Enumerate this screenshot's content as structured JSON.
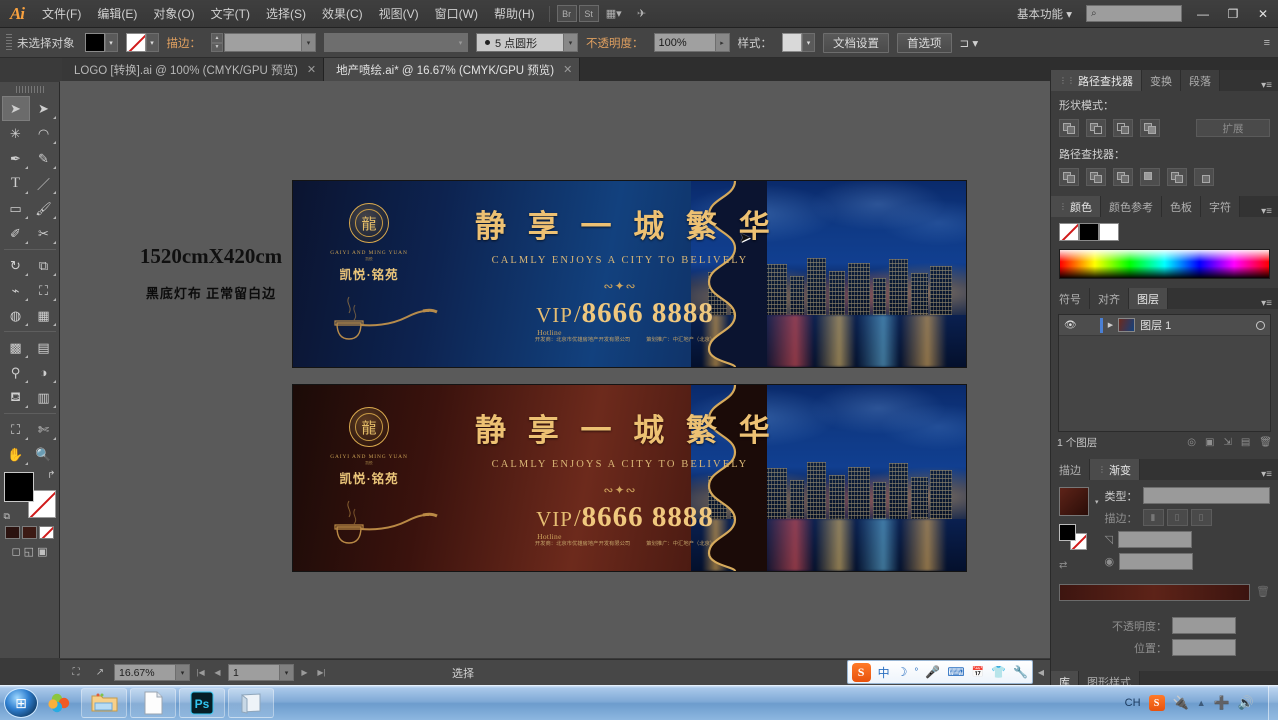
{
  "app": {
    "logo": "Ai",
    "title": "Adobe Illustrator"
  },
  "menubar": {
    "items": [
      "文件(F)",
      "编辑(E)",
      "对象(O)",
      "文字(T)",
      "选择(S)",
      "效果(C)",
      "视图(V)",
      "窗口(W)",
      "帮助(H)"
    ],
    "br_icon": "Br",
    "st_icon": "St",
    "arrange_icon": "arrange-documents-icon",
    "workspace": "基本功能",
    "search_placeholder": "",
    "win_min": "—",
    "win_max": "❐",
    "win_close": "✕"
  },
  "controlbar": {
    "selection_label": "未选择对象",
    "fill_color": "#000000",
    "stroke_color": "none",
    "stroke_label": "描边：",
    "stroke_weight": "",
    "profile": "",
    "brush": "5 点圆形",
    "opacity_label": "不透明度：",
    "opacity_value": "100%",
    "style_label": "样式：",
    "doc_setup": "文档设置",
    "preferences": "首选项"
  },
  "tabs": [
    {
      "label": "LOGO [转换].ai @ 100% (CMYK/GPU 预览)",
      "active": false,
      "close": "✕"
    },
    {
      "label": "地产喷绘.ai* @ 16.67% (CMYK/GPU 预览)",
      "active": true,
      "close": "✕"
    }
  ],
  "toolbar": {
    "tools": [
      {
        "name": "selection-tool",
        "glyph": "➤",
        "selected": true
      },
      {
        "name": "direct-selection-tool",
        "glyph": "➤",
        "selected": false
      },
      {
        "name": "magic-wand-tool",
        "glyph": "✳",
        "selected": false
      },
      {
        "name": "lasso-tool",
        "glyph": "◠",
        "selected": false
      },
      {
        "name": "pen-tool",
        "glyph": "✒",
        "selected": false
      },
      {
        "name": "curvature-tool",
        "glyph": "✎",
        "selected": false
      },
      {
        "name": "type-tool",
        "glyph": "T",
        "selected": false
      },
      {
        "name": "line-segment-tool",
        "glyph": "／",
        "selected": false
      },
      {
        "name": "rectangle-tool",
        "glyph": "▭",
        "selected": false
      },
      {
        "name": "paintbrush-tool",
        "glyph": "🖌",
        "selected": false
      },
      {
        "name": "pencil-tool",
        "glyph": "✐",
        "selected": false
      },
      {
        "name": "scissors-tool",
        "glyph": "✂",
        "selected": false
      },
      {
        "name": "rotate-tool",
        "glyph": "↻",
        "selected": false
      },
      {
        "name": "scale-tool",
        "glyph": "⤢",
        "selected": false
      },
      {
        "name": "width-tool",
        "glyph": "⌁",
        "selected": false
      },
      {
        "name": "free-transform-tool",
        "glyph": "⧉",
        "selected": false
      },
      {
        "name": "shape-builder-tool",
        "glyph": "◍",
        "selected": false
      },
      {
        "name": "perspective-grid-tool",
        "glyph": "▦",
        "selected": false
      },
      {
        "name": "mesh-tool",
        "glyph": "▩",
        "selected": false
      },
      {
        "name": "gradient-tool",
        "glyph": "▤",
        "selected": false
      },
      {
        "name": "eyedropper-tool",
        "glyph": "⚲",
        "selected": false
      },
      {
        "name": "blend-tool",
        "glyph": "◐",
        "selected": false
      },
      {
        "name": "symbol-sprayer-tool",
        "glyph": "⛾",
        "selected": false
      },
      {
        "name": "column-graph-tool",
        "glyph": "▥",
        "selected": false
      },
      {
        "name": "artboard-tool",
        "glyph": "⛶",
        "selected": false
      },
      {
        "name": "slice-tool",
        "glyph": "✄",
        "selected": false
      },
      {
        "name": "hand-tool",
        "glyph": "✋",
        "selected": false
      },
      {
        "name": "zoom-tool",
        "glyph": "🔍",
        "selected": false
      }
    ],
    "fill_color": "#000000",
    "stroke_color": "none",
    "swap_icon": "↱",
    "default_icon": "⧉",
    "mini_swatches": [
      "#2b1310",
      "#3c1a14",
      "none"
    ],
    "screen_modes": [
      "◻",
      "◱",
      "▣"
    ]
  },
  "canvas": {
    "note_size": "1520cmX420cm",
    "note_sub": "黑底灯布 正常留白边",
    "cursor": "arrow-cursor"
  },
  "artwork": {
    "banners": [
      {
        "variant": "blue",
        "logo_en": "GAIYI AND MING YUAN",
        "logo_tiny": "凯悦",
        "logo_cn": "凯悦·铭苑",
        "headline_cn": "静 享 一 城 繁 华",
        "headline_en": "CALMLY ENJOYS A CITY TO BELIVELY",
        "vip_word": "VIP",
        "vip_hotline": "Hotline",
        "vip_slash": "/",
        "vip_number": "8666 8888",
        "fine_left": "开发商：北京市优雄房地产开发有限公司",
        "fine_right": "策划推广：中汇地产（北京）"
      },
      {
        "variant": "brown",
        "logo_en": "GAIYI AND MING YUAN",
        "logo_tiny": "凯悦",
        "logo_cn": "凯悦·铭苑",
        "headline_cn": "静 享 一 城 繁 华",
        "headline_en": "CALMLY ENJOYS A CITY TO BELIVELY",
        "vip_word": "VIP",
        "vip_hotline": "Hotline",
        "vip_slash": "/",
        "vip_number": "8666 8888",
        "fine_left": "开发商：北京市优雄房地产开发有限公司",
        "fine_right": "策划推广：中汇地产（北京）"
      }
    ]
  },
  "panels": {
    "pathfinder": {
      "tabs": [
        "路径查找器",
        "变换",
        "段落"
      ],
      "active_tab": "路径查找器",
      "shape_modes_label": "形状模式：",
      "expand_label": "扩展",
      "pathfinder_label": "路径查找器：",
      "shape_mode_buttons": [
        "unite",
        "minus-front",
        "intersect",
        "exclude"
      ],
      "pathfinder_buttons": [
        "divide",
        "trim",
        "merge",
        "crop",
        "outline",
        "minus-back"
      ]
    },
    "color": {
      "tabs": [
        "颜色",
        "颜色参考",
        "色板",
        "字符"
      ],
      "active_tab": "颜色",
      "swatches": [
        "none",
        "#000000",
        "#ffffff"
      ]
    },
    "layers": {
      "tabs": [
        "符号",
        "对齐",
        "图层"
      ],
      "active_tab": "图层",
      "rows": [
        {
          "name": "图层 1",
          "visible": true,
          "locked": false
        }
      ],
      "footer_count": "1 个图层",
      "footer_icons": [
        "make-clipping-mask",
        "make-sublayer",
        "new-layer",
        "delete-layer"
      ]
    },
    "gradient": {
      "tabs": [
        "描边",
        "渐变"
      ],
      "active_tab": "渐变",
      "type_label": "类型：",
      "type_value": "",
      "stroke_label": "描边：",
      "angle_label": "",
      "ratio_label": "",
      "opacity_label": "不透明度：",
      "opacity_value": "",
      "location_label": "位置：",
      "location_value": "",
      "ramp_from": "#3d1510",
      "ramp_to": "#5d2318"
    },
    "bottom_tabs": [
      "库",
      "图形样式"
    ]
  },
  "statusbar": {
    "zoom": "16.67%",
    "page": "1",
    "status_text": "选择",
    "icons": [
      "artboard-nav-icon",
      "export-icon"
    ]
  },
  "ime": {
    "logo": "S",
    "items": [
      "中",
      "☽",
      "°",
      "🎤",
      "⌨",
      "📅",
      "👕",
      "🔧"
    ]
  },
  "taskbar": {
    "start": "start-orb",
    "apps": [
      "sogou-browser",
      "file-explorer",
      "document",
      "photoshop",
      "notepad"
    ],
    "tray_lang": "CH",
    "tray_items": [
      "sogou-input",
      "usb-device",
      "show-hidden-icons",
      "update",
      "volume"
    ]
  }
}
